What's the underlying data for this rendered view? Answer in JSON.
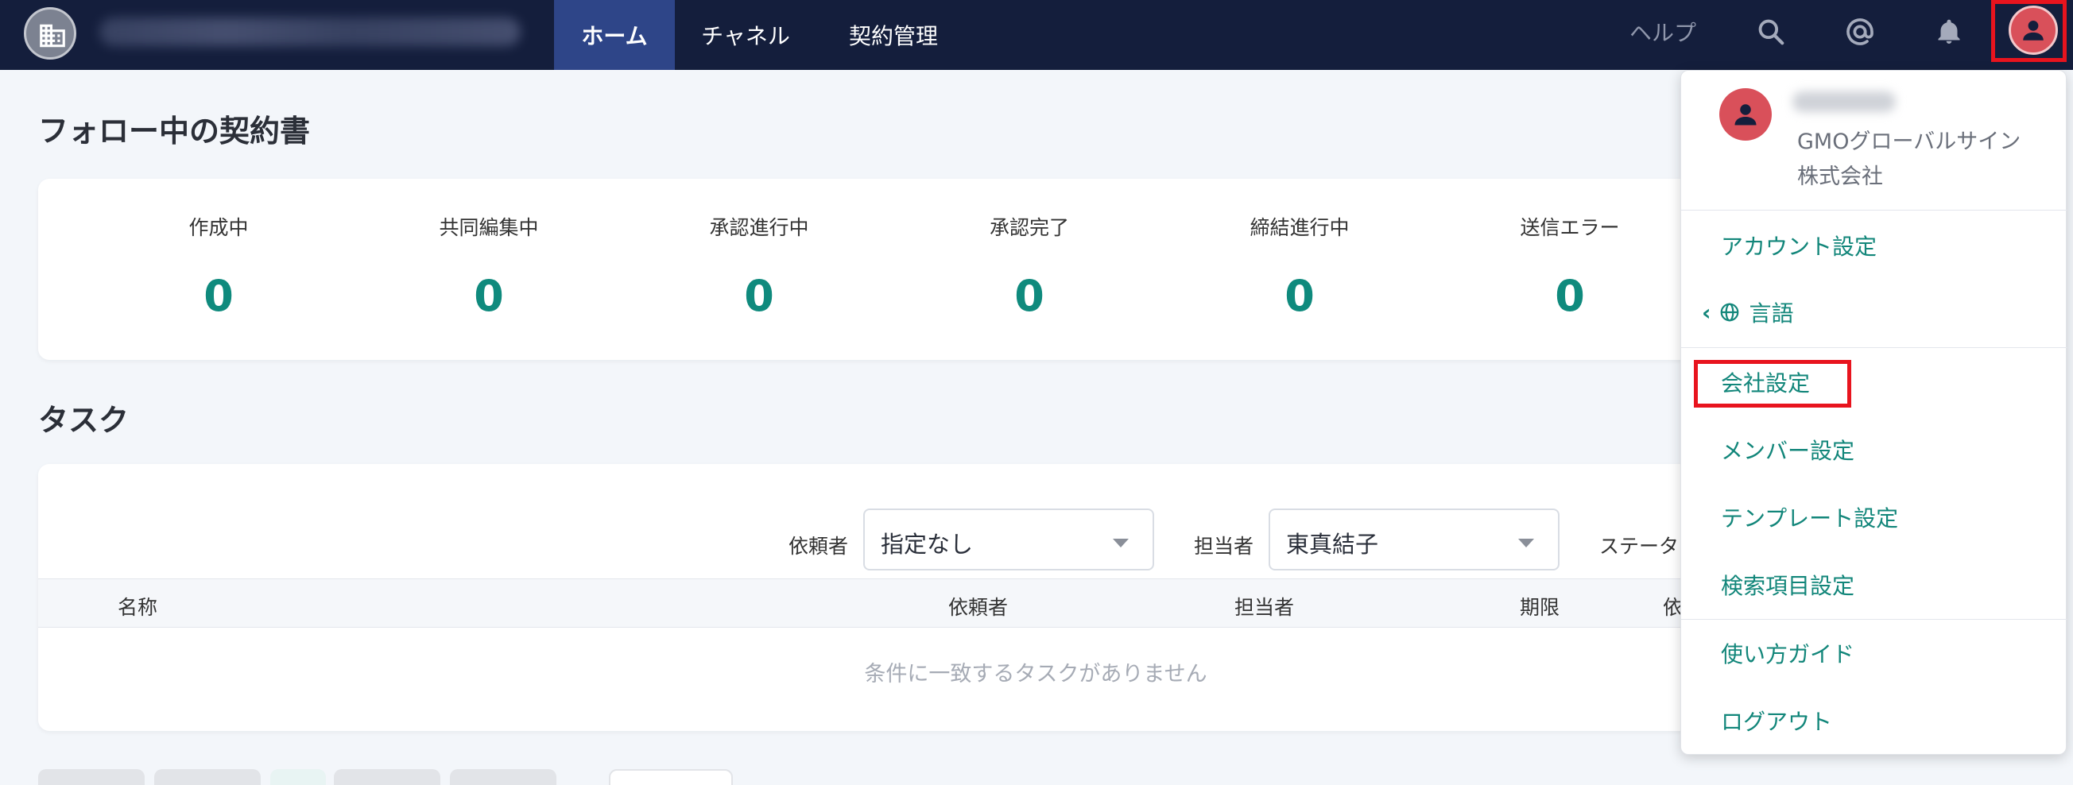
{
  "nav": {
    "tabs": [
      "ホーム",
      "チャネル",
      "契約管理"
    ],
    "help": "ヘルプ",
    "icons": [
      "search-icon",
      "at-icon",
      "bell-icon",
      "user-icon"
    ]
  },
  "follow_section": {
    "title": "フォロー中の契約書",
    "stats": [
      {
        "label": "作成中",
        "value": "0"
      },
      {
        "label": "共同編集中",
        "value": "0"
      },
      {
        "label": "承認進行中",
        "value": "0"
      },
      {
        "label": "承認完了",
        "value": "0"
      },
      {
        "label": "締結進行中",
        "value": "0"
      },
      {
        "label": "送信エラー",
        "value": "0"
      }
    ]
  },
  "task_section": {
    "title": "タスク",
    "filters": {
      "requester_label": "依頼者",
      "requester_value": "指定なし",
      "assignee_label": "担当者",
      "assignee_value": "東真結子",
      "status_label": "ステータ"
    },
    "columns": [
      "名称",
      "依頼者",
      "担当者",
      "期限",
      "依"
    ],
    "empty_message": "条件に一致するタスクがありません"
  },
  "user_menu": {
    "company": "GMOグローバルサイン株式会社",
    "items": {
      "account": "アカウント設定",
      "language": "言語",
      "company_settings": "会社設定",
      "member_settings": "メンバー設定",
      "template_settings": "テンプレート設定",
      "search_settings": "検索項目設定",
      "guide": "使い方ガイド",
      "logout": "ログアウト"
    }
  },
  "colors": {
    "nav_bg": "#141e3c",
    "nav_active": "#2e4588",
    "accent": "#0f8a7d",
    "highlight": "#e8141e",
    "avatar": "#d9505a"
  }
}
